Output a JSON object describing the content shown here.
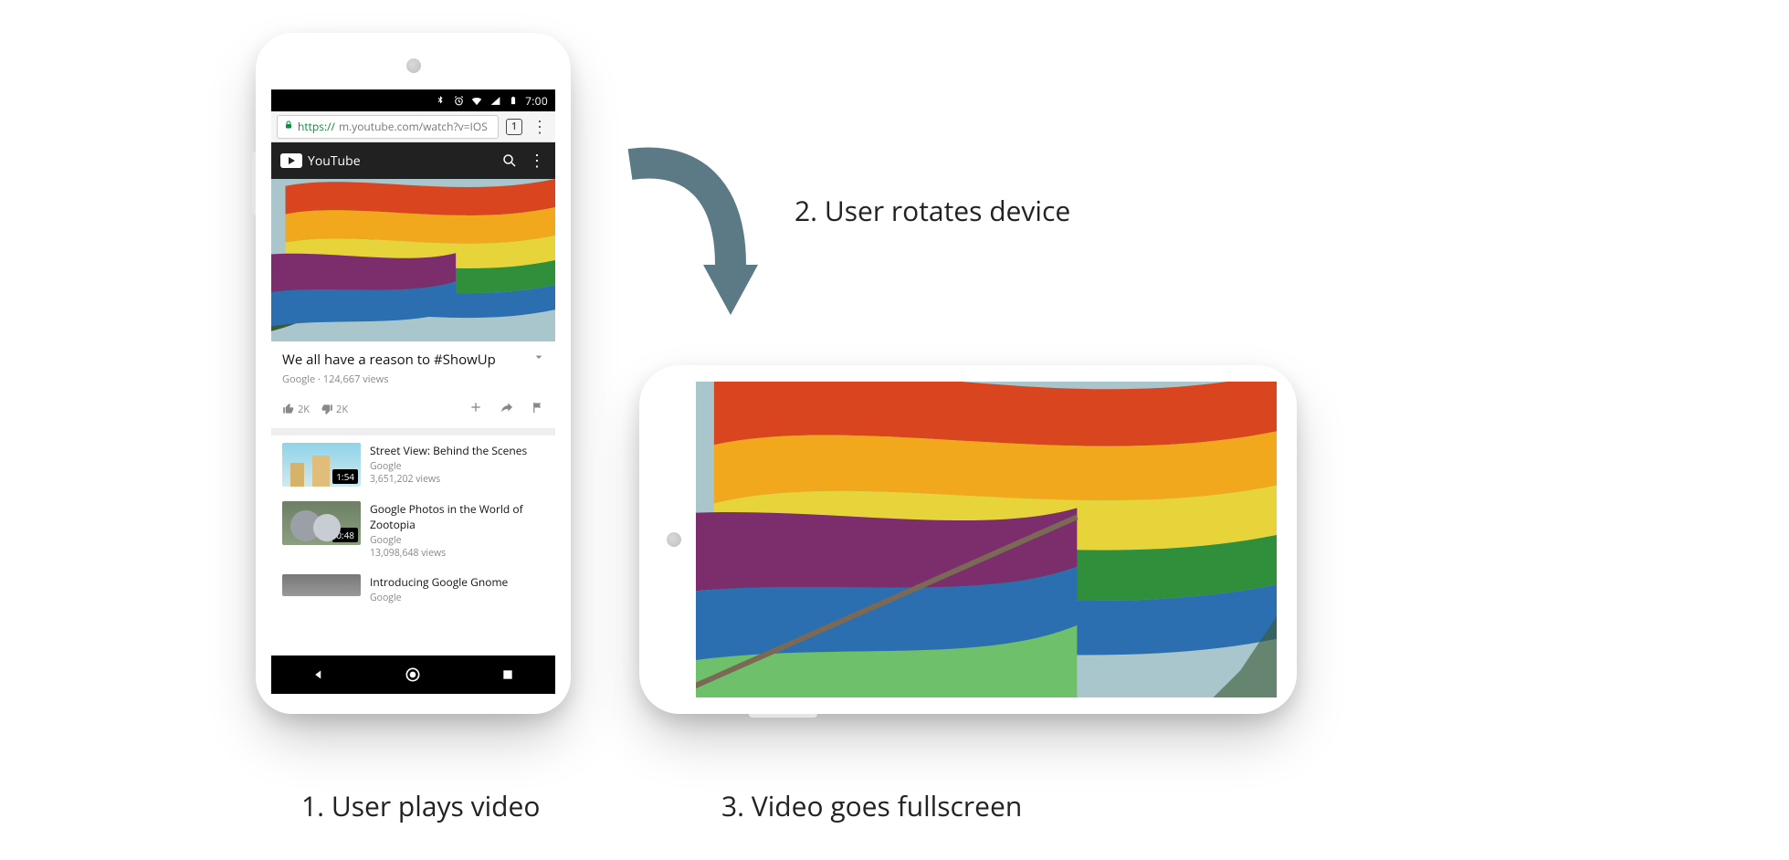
{
  "captions": {
    "step1": "1. User plays video",
    "step2": "2. User rotates device",
    "step3": "3. Video goes fullscreen"
  },
  "statusbar": {
    "time": "7:00"
  },
  "omnibox": {
    "https": "https://",
    "host_path": "m.youtube.com/watch?v=IOS",
    "tab_count": "1"
  },
  "youtube_header": {
    "brand": "YouTube"
  },
  "video": {
    "title": "We all have a reason to #ShowUp",
    "channel": "Google",
    "views": "124,667 views",
    "likes": "2K",
    "dislikes": "2K"
  },
  "related": [
    {
      "title": "Street View: Behind the Scenes",
      "channel": "Google",
      "views": "3,651,202 views",
      "duration": "1:54"
    },
    {
      "title": "Google Photos in the World of Zootopia",
      "channel": "Google",
      "views": "13,098,648 views",
      "duration": "0:48"
    },
    {
      "title": "Introducing Google Gnome",
      "channel": "Google",
      "views": "",
      "duration": ""
    }
  ]
}
